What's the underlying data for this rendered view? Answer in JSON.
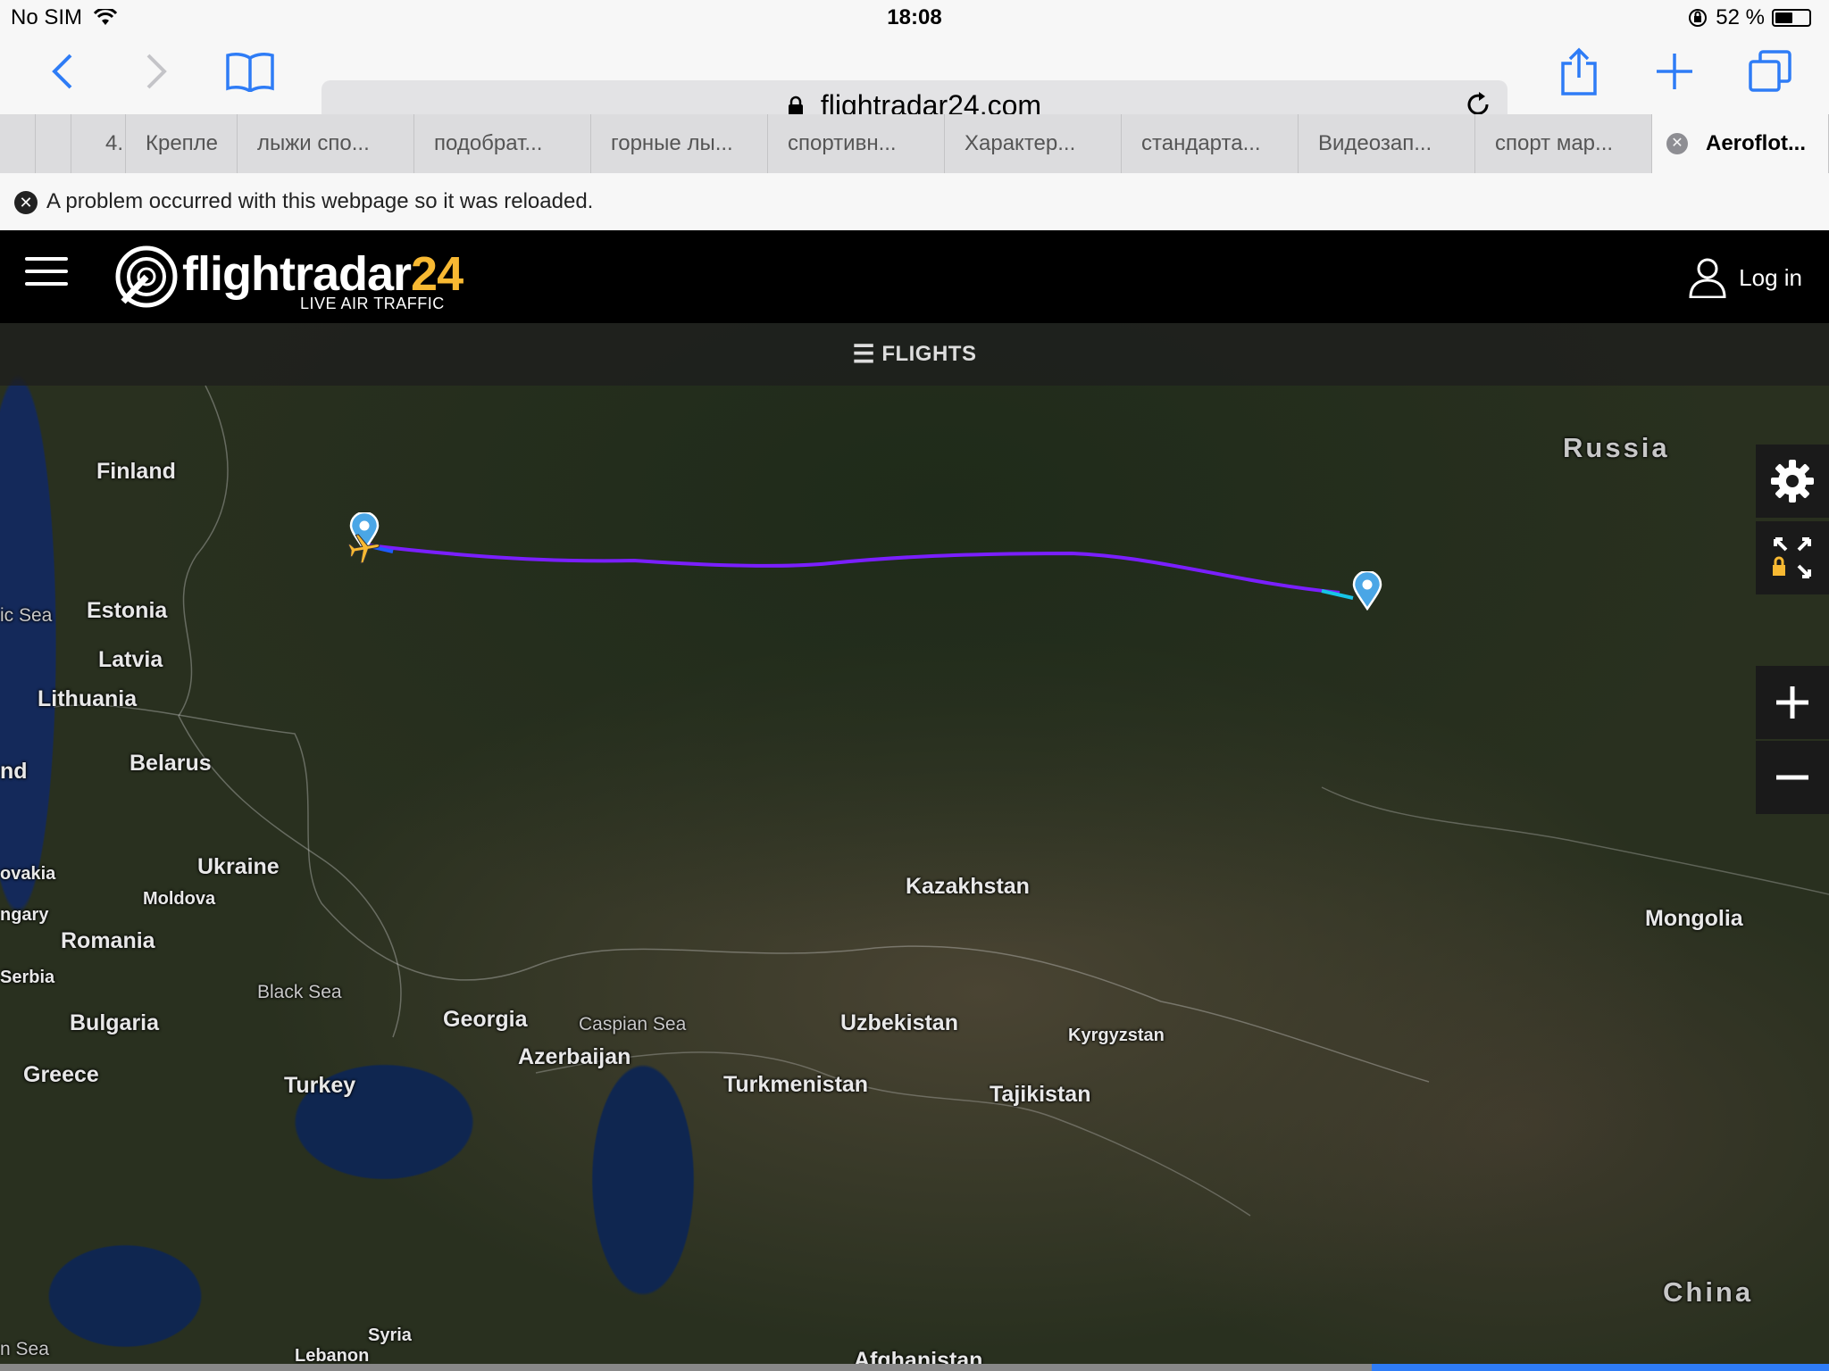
{
  "status": {
    "carrier": "No SIM",
    "time": "18:08",
    "battery": "52 %",
    "battery_level": 0.52
  },
  "browser": {
    "url": "flightradar24.com",
    "tabs": [
      "4.",
      "Крепле",
      "лыжи спо...",
      "подобрат...",
      "горные лы...",
      "спортивн...",
      "Характер...",
      "стандарта...",
      "Видеозап...",
      "спорт мар...",
      "Aeroflot..."
    ],
    "active_tab": 10
  },
  "notice": {
    "text": "A problem occurred with this webpage so it was reloaded."
  },
  "header": {
    "logo_text": "flightradar",
    "logo_num": "24",
    "tagline": "LIVE AIR TRAFFIC",
    "login": "Log in"
  },
  "map": {
    "flights_label": "FLIGHTS",
    "countries": {
      "finland": "Finland",
      "russia": "Russia",
      "estonia": "Estonia",
      "latvia": "Latvia",
      "lithuania": "Lithuania",
      "belarus": "Belarus",
      "ukraine": "Ukraine",
      "moldova": "Moldova",
      "romania": "Romania",
      "serbia": "Serbia",
      "bulgaria": "Bulgaria",
      "greece": "Greece",
      "turkey": "Turkey",
      "georgia": "Georgia",
      "azerbaijan": "Azerbaijan",
      "kazakhstan": "Kazakhstan",
      "uzbekistan": "Uzbekistan",
      "turkmenistan": "Turkmenistan",
      "kyrgyzstan": "Kyrgyzstan",
      "tajikistan": "Tajikistan",
      "mongolia": "Mongolia",
      "china": "China",
      "syria": "Syria",
      "lebanon": "Lebanon",
      "afghanistan": "Afghanistan",
      "slovakia_partial": "ovakia",
      "hungary_partial": "ngary",
      "poland_partial": "nd"
    },
    "seas": {
      "baltic": "ic Sea",
      "black": "Black Sea",
      "caspian": "Caspian Sea",
      "med": "n Sea"
    }
  },
  "colors": {
    "route": "#7a1fff",
    "logo_accent": "#f8b932",
    "safari_blue": "#2e7cf6"
  }
}
